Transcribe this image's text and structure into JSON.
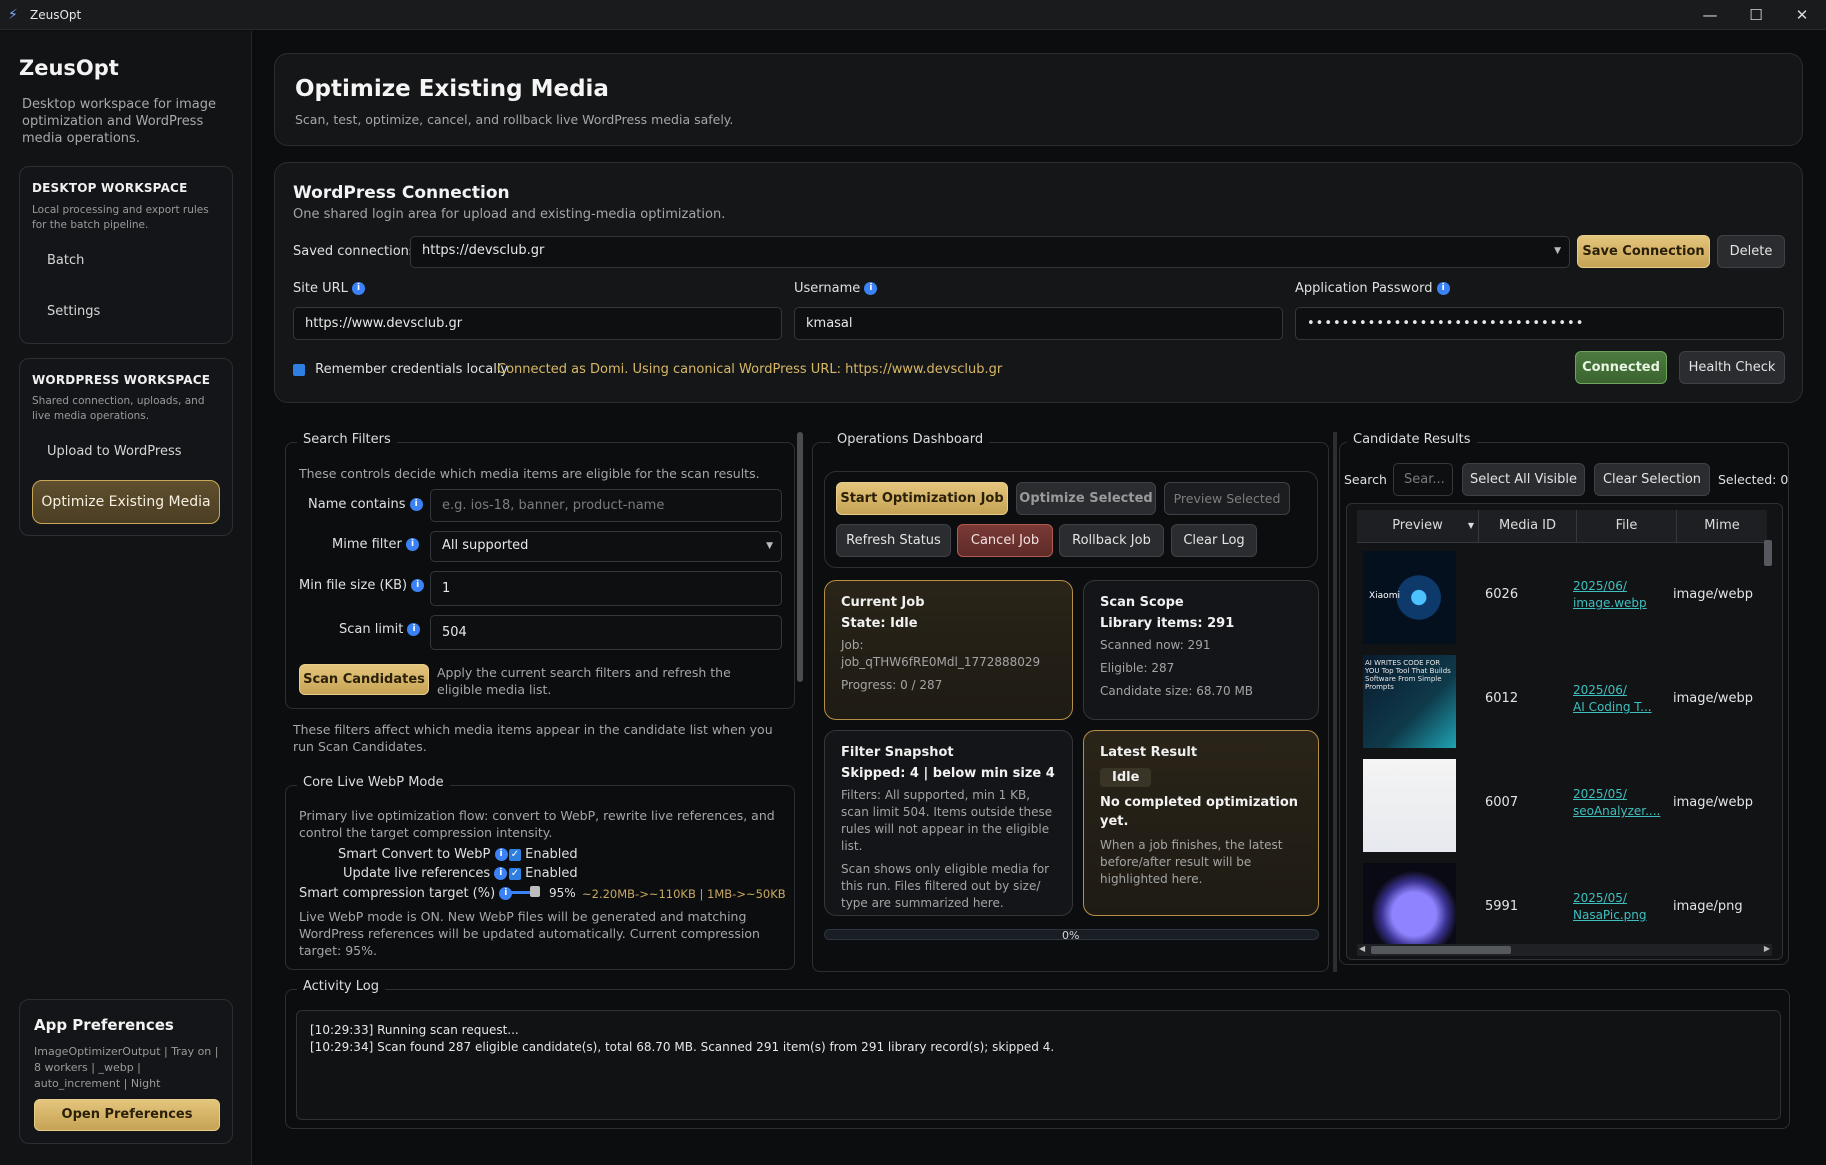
{
  "window": {
    "title": "ZeusOpt",
    "minimize": "—",
    "maximize": "☐",
    "close": "✕"
  },
  "sidebar": {
    "brand": "ZeusOpt",
    "brand_sub": "Desktop workspace for image optimization and WordPress media operations.",
    "desktop": {
      "title": "DESKTOP WORKSPACE",
      "desc": "Local processing and export rules for the batch pipeline.",
      "items": [
        "Batch",
        "Settings"
      ]
    },
    "wordpress": {
      "title": "WORDPRESS WORKSPACE",
      "desc": "Shared connection, uploads, and live media operations.",
      "items": [
        "Upload to WordPress",
        "Optimize Existing Media"
      ]
    },
    "prefs": {
      "title": "App Preferences",
      "desc": "ImageOptimizerOutput | Tray on | 8 workers | _webp | auto_increment | Night",
      "button": "Open Preferences"
    }
  },
  "header": {
    "title": "Optimize Existing Media",
    "subtitle": "Scan, test, optimize, cancel, and rollback live WordPress media safely."
  },
  "connection": {
    "title": "WordPress Connection",
    "subtitle": "One shared login area for upload and existing-media optimization.",
    "saved_label": "Saved connections",
    "saved_value": "https://devsclub.gr",
    "save_button": "Save Connection",
    "delete_button": "Delete",
    "site_url_label": "Site URL",
    "site_url_value": "https://www.devsclub.gr",
    "username_label": "Username",
    "username_value": "kmasal",
    "password_label": "Application Password",
    "password_value": "••••••••••••••••••••••••••••••••",
    "remember_label": "Remember credentials locally",
    "status_text": "Connected as Domi. Using canonical WordPress URL: https://www.devsclub.gr",
    "connected_button": "Connected",
    "health_button": "Health Check"
  },
  "filters": {
    "title": "Search Filters",
    "desc": "These controls decide which media items are eligible for the scan results.",
    "name_label": "Name contains",
    "name_placeholder": "e.g. ios-18, banner, product-name",
    "mime_label": "Mime filter",
    "mime_value": "All supported",
    "minsize_label": "Min file size (KB)",
    "minsize_value": "1",
    "limit_label": "Scan limit",
    "limit_value": "504",
    "scan_button": "Scan Candidates",
    "scan_hint": "Apply the current search filters and refresh the eligible media list.",
    "note": "These filters affect which media items appear in the candidate list when you run Scan Candidates."
  },
  "webp": {
    "title": "Core Live WebP Mode",
    "desc": "Primary live optimization flow: convert to WebP, rewrite live references, and control the target compression intensity.",
    "smart_label": "Smart Convert to WebP",
    "smart_value": "Enabled",
    "update_label": "Update live references",
    "update_value": "Enabled",
    "compression_label": "Smart compression target (%)",
    "compression_value": "95%",
    "compression_hint": "~2.20MB->~110KB | 1MB->~50KB",
    "compression_fraction": 0.95,
    "status": "Live WebP mode is ON. New WebP files will be generated and matching WordPress references will be updated automatically. Current compression target: 95%."
  },
  "ops": {
    "title": "Operations Dashboard",
    "buttons": {
      "start": "Start Optimization Job",
      "optimize": "Optimize Selected",
      "preview": "Preview Selected",
      "refresh": "Refresh Status",
      "cancel": "Cancel Job",
      "rollback": "Rollback Job",
      "clear": "Clear Log"
    },
    "current": {
      "title": "Current Job",
      "state": "State: Idle",
      "job": "Job: job_qTHW6fRE0Mdl_1772888029",
      "progress": "Progress: 0 / 287"
    },
    "scope": {
      "title": "Scan Scope",
      "library": "Library items: 291",
      "scanned": "Scanned now: 291",
      "eligible": "Eligible: 287",
      "size": "Candidate size: 68.70 MB"
    },
    "snapshot": {
      "title": "Filter Snapshot",
      "skipped": "Skipped: 4 | below min size 4",
      "text1": "Filters: All supported, min 1 KB, scan limit 504. Items outside these rules will not appear in the eligible list.",
      "text2": "Scan shows only eligible media for this run. Files filtered out by size/ type are summarized here."
    },
    "latest": {
      "title": "Latest Result",
      "badge": "Idle",
      "big": "No completed optimization yet.",
      "text": "When a job finishes, the latest before/after result will be highlighted here."
    },
    "progress_label": "0%",
    "progress_fraction": 0
  },
  "candidates": {
    "title": "Candidate Results",
    "search_label": "Search",
    "search_placeholder": "Sear...",
    "select_all": "Select All Visible",
    "clear_selection": "Clear Selection",
    "selected": "Selected: 0",
    "columns": [
      "Preview",
      "Media ID",
      "File",
      "Mime"
    ],
    "rows": [
      {
        "id": "6026",
        "file1": "2025/06/",
        "file2": "image.webp",
        "mime": "image/webp",
        "thumb_caption": "Xiaomi"
      },
      {
        "id": "6012",
        "file1": "2025/06/",
        "file2": "AI Coding T...",
        "mime": "image/webp",
        "thumb_caption": "AI WRITES CODE FOR YOU Top Tool That Builds Software From Simple Prompts"
      },
      {
        "id": "6007",
        "file1": "2025/05/",
        "file2": "seoAnalyzer....",
        "mime": "image/webp",
        "thumb_caption": ""
      },
      {
        "id": "5991",
        "file1": "2025/05/",
        "file2": "NasaPic.png",
        "mime": "image/png",
        "thumb_caption": ""
      }
    ]
  },
  "log": {
    "title": "Activity Log",
    "lines": [
      "[10:29:33] Running scan request...",
      "[10:29:34] Scan found 287 eligible candidate(s), total 68.70 MB. Scanned 291 item(s) from 291 library record(s); skipped 4."
    ]
  }
}
